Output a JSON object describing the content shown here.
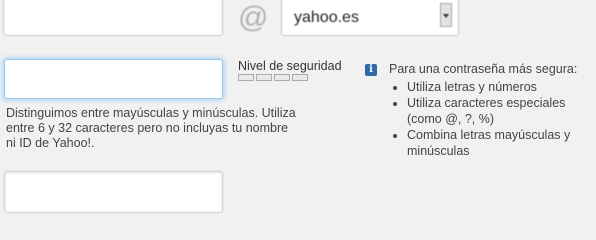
{
  "account": {
    "username_value": "",
    "at_symbol": "@",
    "domain_selected": "yahoo.es"
  },
  "password": {
    "value": "",
    "hint": "Distinguimos entre mayúsculas y minúsculas. Utiliza entre 6 y 32 caracteres pero no incluyas tu nombre ni ID de Yahoo!.",
    "strength_label": "Nivel de seguridad",
    "strength_level": 0,
    "strength_segments": 4
  },
  "tips": {
    "title": "Para una contraseña más segura:",
    "items": [
      "Utiliza letras y números",
      "Utiliza caracteres especiales (como @, ?, %)",
      "Combina letras mayúsculas y minúsculas"
    ]
  },
  "confirm": {
    "value": ""
  },
  "colors": {
    "focus_glow": "#b6d9f6",
    "info_icon": "#2f6aa8"
  },
  "icons": {
    "info": "info-icon",
    "dropdown": "chevron-down-icon"
  }
}
